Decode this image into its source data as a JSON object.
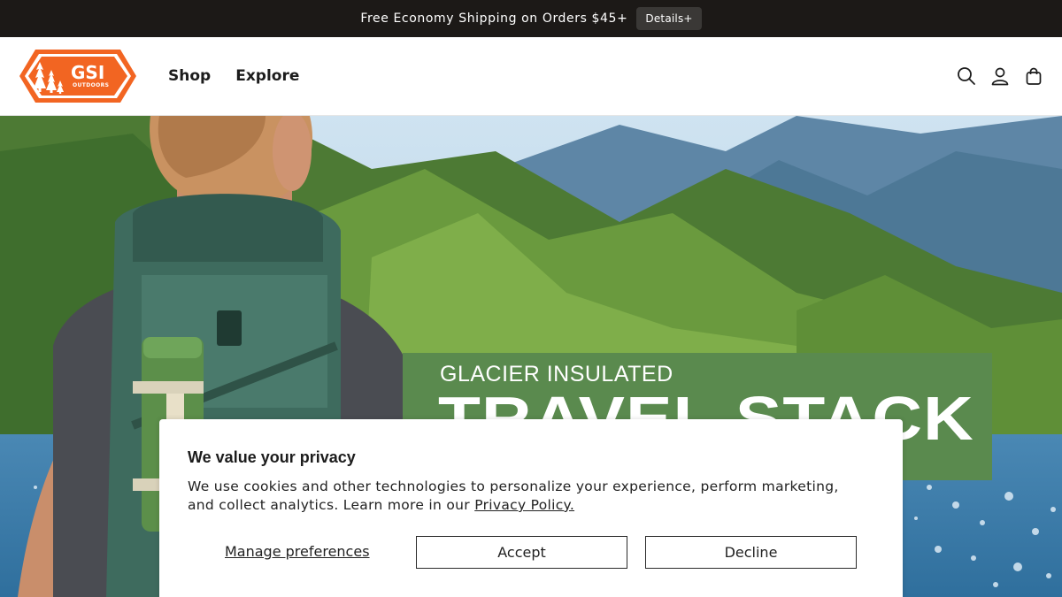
{
  "announcement": {
    "text": "Free Economy Shipping on Orders $45+",
    "details_label": "Details+"
  },
  "header": {
    "logo": {
      "brand": "GSI",
      "sub": "OUTDOORS",
      "color": "#f26522"
    },
    "nav": [
      {
        "label": "Shop"
      },
      {
        "label": "Explore"
      }
    ],
    "icons": [
      "search-icon",
      "account-icon",
      "cart-icon"
    ]
  },
  "hero": {
    "promo_subtitle": "GLACIER INSULATED",
    "promo_title": "TRAVEL STACK",
    "promo_color": "#5a8a4e"
  },
  "cookie_banner": {
    "title": "We value your privacy",
    "body": "We use cookies and other technologies to personalize your experience, perform marketing, and collect analytics. Learn more in our ",
    "link_label": "Privacy Policy.",
    "manage_label": "Manage preferences",
    "accept_label": "Accept",
    "decline_label": "Decline"
  }
}
